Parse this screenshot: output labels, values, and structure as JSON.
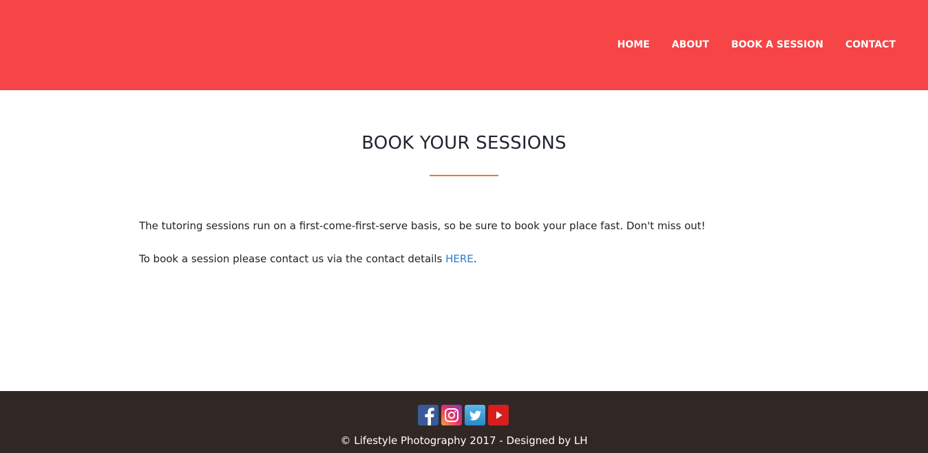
{
  "header": {
    "nav": [
      {
        "label": "HOME"
      },
      {
        "label": "ABOUT"
      },
      {
        "label": "BOOK A SESSION"
      },
      {
        "label": "CONTACT"
      }
    ]
  },
  "main": {
    "title": "BOOK YOUR SESSIONS",
    "paragraph_1": "The tutoring sessions run on a first-come-first-serve basis, so be sure to book your place fast. Don't miss out!",
    "paragraph_2_prefix": "To book a session please contact us via the contact details ",
    "paragraph_2_link": "HERE",
    "paragraph_2_suffix": "."
  },
  "footer": {
    "socials": [
      {
        "name": "facebook-icon"
      },
      {
        "name": "instagram-icon"
      },
      {
        "name": "twitter-icon"
      },
      {
        "name": "youtube-icon"
      }
    ],
    "copyright": "© Lifestyle Photography 2017 - Designed by LH"
  },
  "colors": {
    "header_bg": "#f64447",
    "footer_bg": "#312826",
    "accent_underline": "#e07b39",
    "link": "#2b7bd0"
  }
}
